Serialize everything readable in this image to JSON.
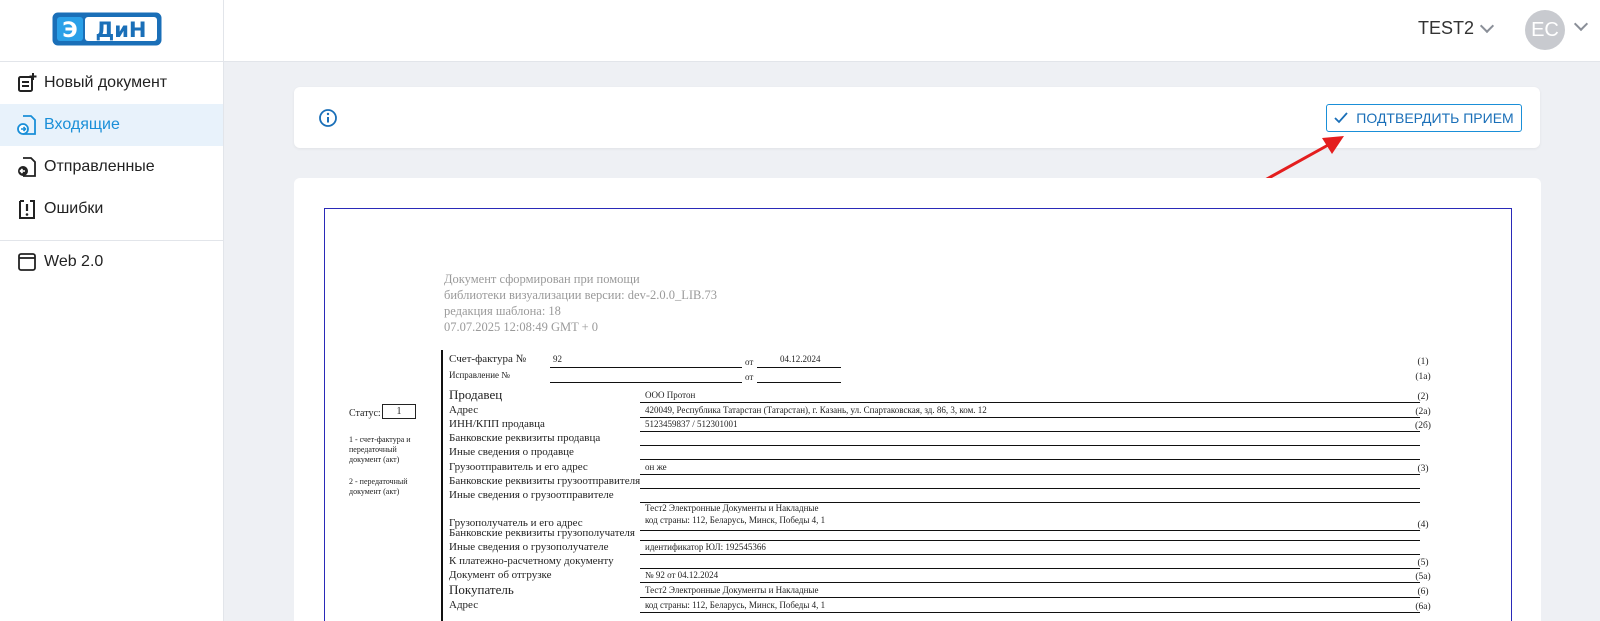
{
  "header": {
    "logo_text": "ЭДиН",
    "account_name": "TEST2",
    "avatar_initials": "EC"
  },
  "sidebar": {
    "items": [
      {
        "label": "Новый документ",
        "icon": "new-document-icon",
        "active": false
      },
      {
        "label": "Входящие",
        "icon": "incoming-icon",
        "active": true
      },
      {
        "label": "Отправленные",
        "icon": "sent-icon",
        "active": false
      },
      {
        "label": "Ошибки",
        "icon": "errors-icon",
        "active": false
      },
      {
        "label": "Web 2.0",
        "icon": "window-icon",
        "active": false
      }
    ]
  },
  "toolbar": {
    "confirm_label": "ПОДТВЕРДИТЬ ПРИЕМ"
  },
  "colors": {
    "accent": "#1a8fd8",
    "arrow": "#e41e1e",
    "frame": "#2a2ab8"
  },
  "document": {
    "meta": [
      "Документ сформирован при помощи",
      "библиотеки визуализации версии: dev-2.0.0_LIB.73",
      "редакция шаблона: 18",
      "07.07.2025 12:08:49 GMT + 0"
    ],
    "invoice_label": "Счет-фактура  №",
    "invoice_number": "92",
    "from_label": "от",
    "invoice_date": "04.12.2024",
    "correction_label": "Исправление №",
    "code_1": "(1)",
    "code_1a": "(1а)",
    "status_label": "Статус:",
    "status_value": "1",
    "status_note_1": "1 - счет-фактура и передаточный документ (акт)",
    "status_note_2": "2 - передаточный документ (акт)",
    "rows": [
      {
        "label": "Продавец",
        "value": "ООО Протон",
        "code": "(2)"
      },
      {
        "label": "Адрес",
        "value": "420049, Республика Татарстан (Татарстан), г. Казань, ул. Спартаковская, зд. 86, 3, ком. 12",
        "code": "(2а)"
      },
      {
        "label": "ИНН/КПП продавца",
        "value": "5123459837 / 512301001",
        "code": "(2б)"
      },
      {
        "label": "Банковские реквизиты продавца",
        "value": "",
        "code": ""
      },
      {
        "label": "Иные сведения о продавце",
        "value": "",
        "code": ""
      },
      {
        "label": "Грузоотправитель и его адрес",
        "value": "он же",
        "code": "(3)"
      },
      {
        "label": "Банковские реквизиты грузоотправителя",
        "value": "",
        "code": ""
      },
      {
        "label": "Иные сведения о грузоотправителе",
        "value": "",
        "code": ""
      },
      {
        "label": "Грузополучатель и его адрес",
        "value": "Тест2 Электронные Документы и Накладные",
        "value2": "код страны: 112, Беларусь, Минск, Победы 4, 1",
        "code": "(4)"
      },
      {
        "label": "Банковские реквизиты грузополучателя",
        "value": "",
        "code": ""
      },
      {
        "label": "Иные сведения о грузополучателе",
        "value": "идентификатор ЮЛ: 192545366",
        "code": ""
      },
      {
        "label": "К платежно-расчетному документу",
        "value": "",
        "code": "(5)"
      },
      {
        "label": "Документ об отгрузке",
        "value": "№ 92  от 04.12.2024",
        "code": "(5а)"
      },
      {
        "label": "Покупатель",
        "value": "Тест2 Электронные Документы и Накладные",
        "code": "(6)"
      },
      {
        "label": "Адрес",
        "value": "код страны: 112, Беларусь, Минск, Победы 4, 1",
        "code": "(6а)"
      }
    ]
  }
}
